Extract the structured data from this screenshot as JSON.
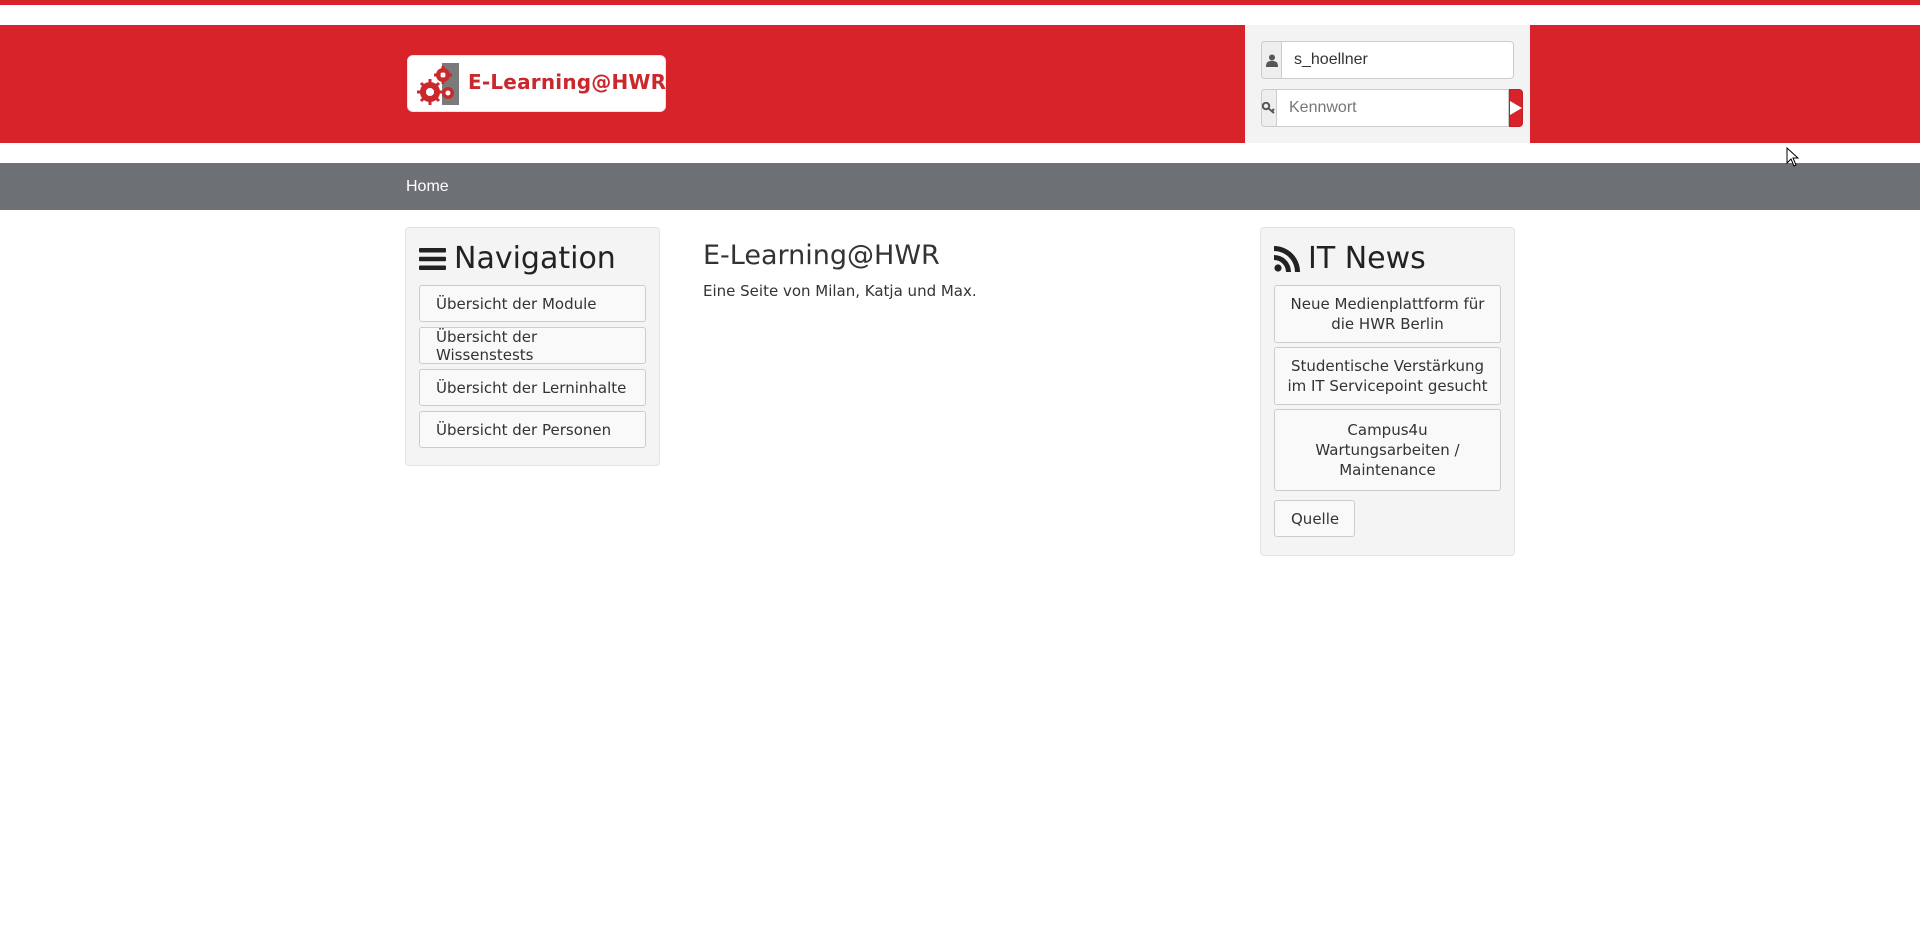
{
  "header": {
    "logo_text": "E-Learning@HWR",
    "accent_color": "#d9232a"
  },
  "login": {
    "username_value": "s_hoellner",
    "password_placeholder": "Kennwort",
    "user_icon": "user-icon",
    "key_icon": "key-icon",
    "submit_icon": "play-icon"
  },
  "navbar": {
    "home_label": "Home"
  },
  "sidebar": {
    "title": "Navigation",
    "title_icon": "bars-icon",
    "items": [
      {
        "label": "Übersicht der Module"
      },
      {
        "label": "Übersicht der Wissenstests"
      },
      {
        "label": "Übersicht der Lerninhalte"
      },
      {
        "label": "Übersicht der Personen"
      }
    ]
  },
  "main": {
    "title": "E-Learning@HWR",
    "subtitle": "Eine Seite von Milan, Katja und Max."
  },
  "news": {
    "title": "IT News",
    "title_icon": "rss-icon",
    "items": [
      {
        "label": "Neue Medienplattform für die HWR Berlin"
      },
      {
        "label": "Studentische Verstärkung im IT Servicepoint gesucht"
      },
      {
        "label": "Campus4u Wartungsarbeiten / Maintenance"
      }
    ],
    "source_label": "Quelle"
  }
}
